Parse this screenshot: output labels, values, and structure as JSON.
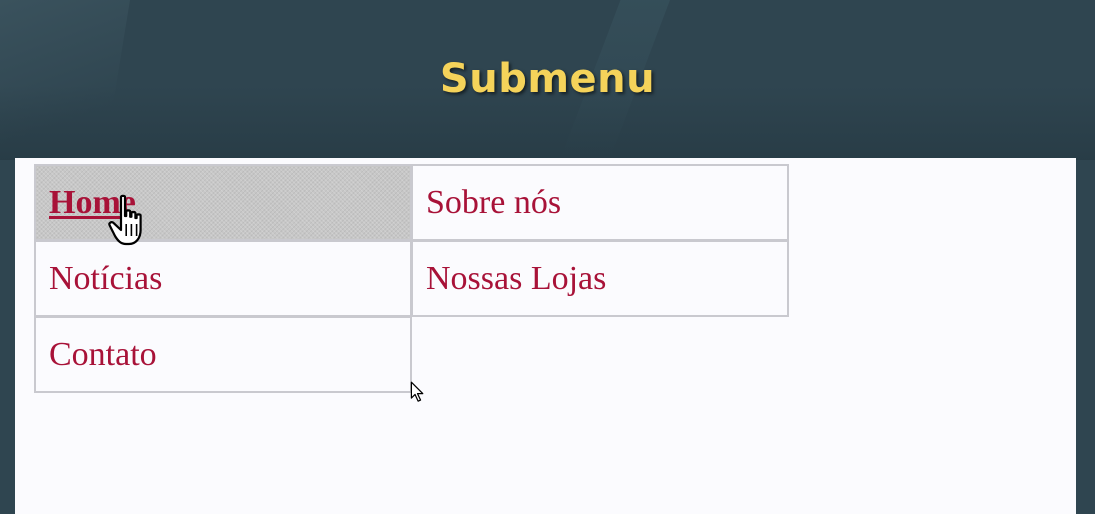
{
  "slide": {
    "title": "Submenu"
  },
  "menu": {
    "items": [
      {
        "label": "Home",
        "state": "hover"
      },
      {
        "label": "Sobre nós"
      },
      {
        "label": "Notícias"
      },
      {
        "label": "Nossas Lojas"
      },
      {
        "label": "Contato"
      }
    ]
  },
  "colors": {
    "title": "#f5d35a",
    "background": "#2f4550",
    "link": "#a81238",
    "hover_cell": "#c7c7c7",
    "cell_border": "#c9c9cf"
  },
  "cursors": [
    "hand-pointer-icon",
    "arrow-pointer-icon"
  ]
}
